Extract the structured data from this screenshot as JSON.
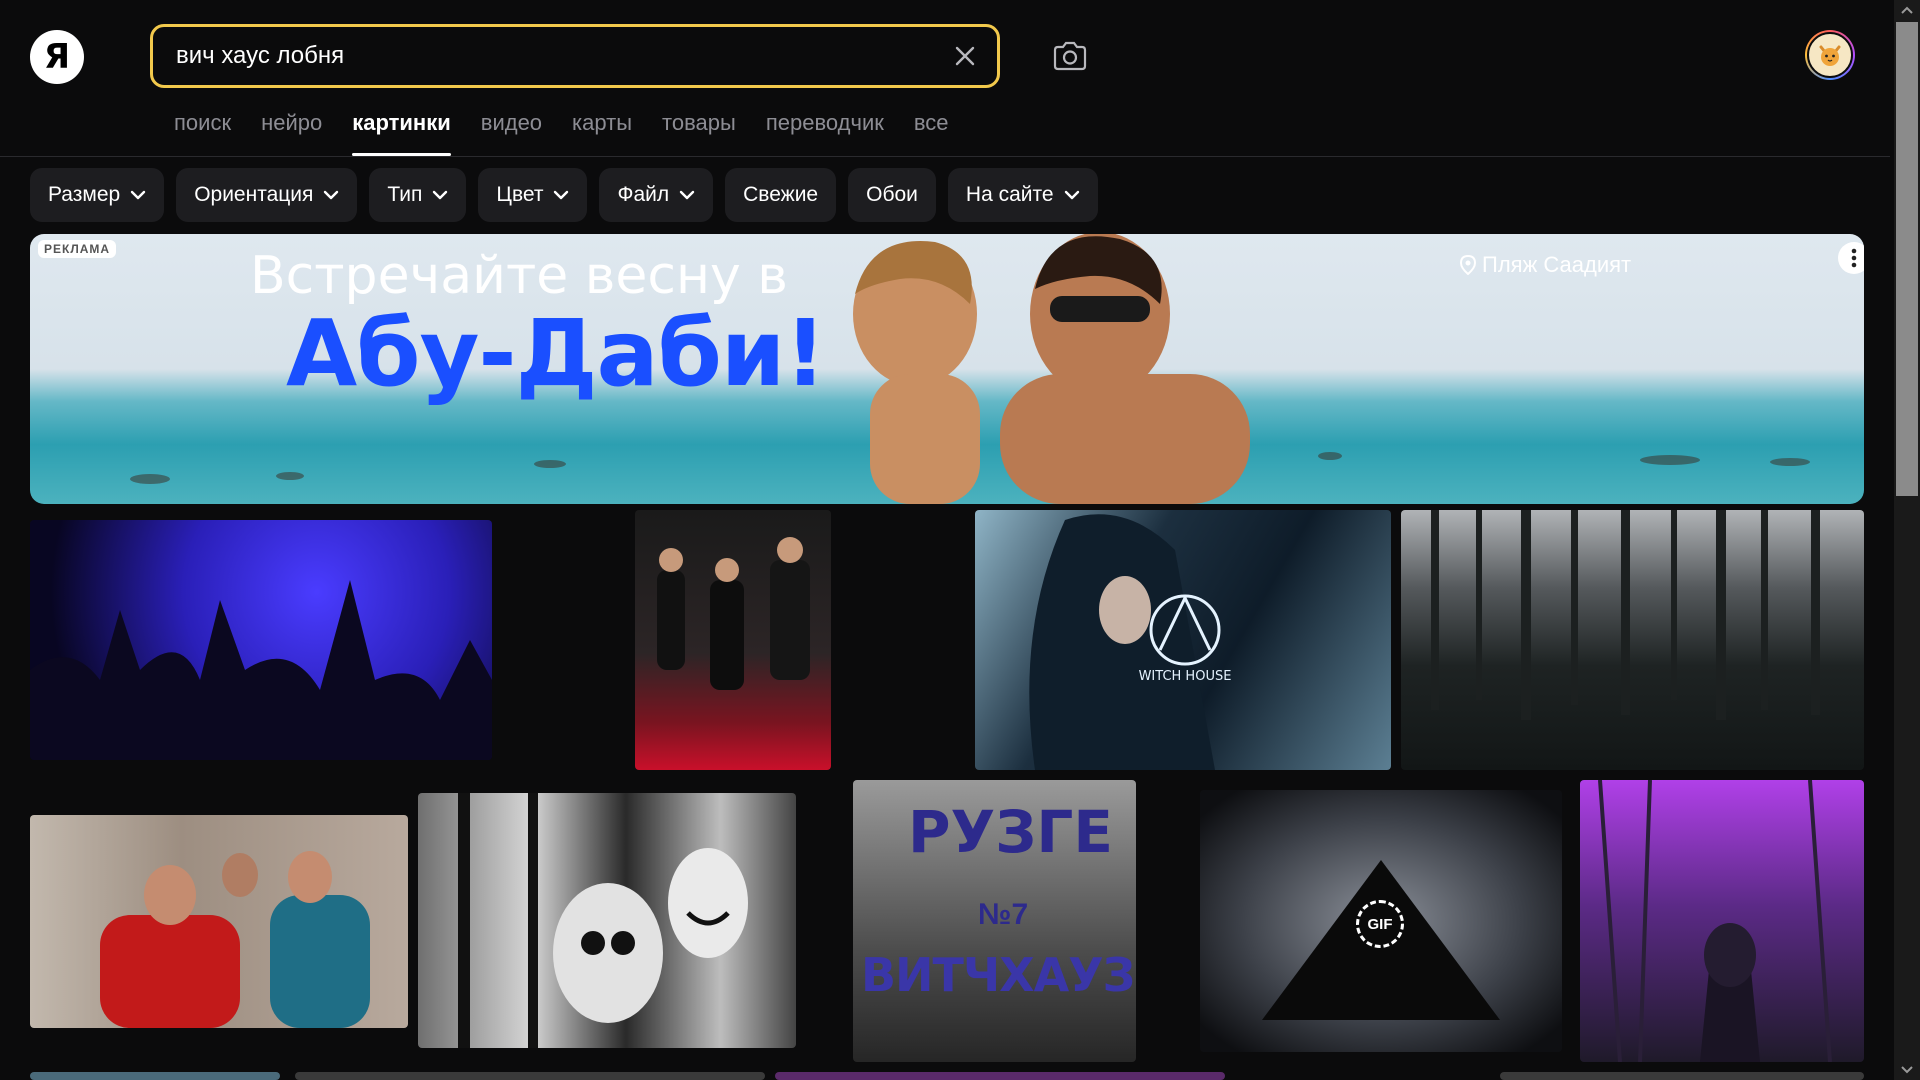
{
  "logo": {
    "letter": "Я"
  },
  "search": {
    "value": "вич хаус лобня"
  },
  "tabs": [
    {
      "label": "поиск"
    },
    {
      "label": "нейро"
    },
    {
      "label": "картинки"
    },
    {
      "label": "видео"
    },
    {
      "label": "карты"
    },
    {
      "label": "товары"
    },
    {
      "label": "переводчик"
    },
    {
      "label": "все"
    }
  ],
  "active_tab": "картинки",
  "filters": [
    {
      "label": "Размер",
      "dropdown": true
    },
    {
      "label": "Ориентация",
      "dropdown": true
    },
    {
      "label": "Тип",
      "dropdown": true
    },
    {
      "label": "Цвет",
      "dropdown": true
    },
    {
      "label": "Файл",
      "dropdown": true
    },
    {
      "label": "Свежие",
      "dropdown": false
    },
    {
      "label": "Обои",
      "dropdown": false
    },
    {
      "label": "На сайте",
      "dropdown": true
    }
  ],
  "ad": {
    "badge": "РЕКЛАМА",
    "headline": "Встречайте весну в",
    "destination": "Абу-Даби!",
    "location": "Пляж Саадият"
  },
  "images": {
    "tile7_title": "РУЗГЕ",
    "tile7_number": "№7",
    "tile7_subtitle": "ВИТЧХАУЗЕ",
    "tile3_logo": "WITCH HOUSE",
    "tile8_badge": "GIF"
  },
  "colors": {
    "background": "#0b0b0c",
    "search_border": "#f2c94c",
    "chip_bg": "#1d1d20",
    "ad_headline_blue": "#1a4fff"
  }
}
